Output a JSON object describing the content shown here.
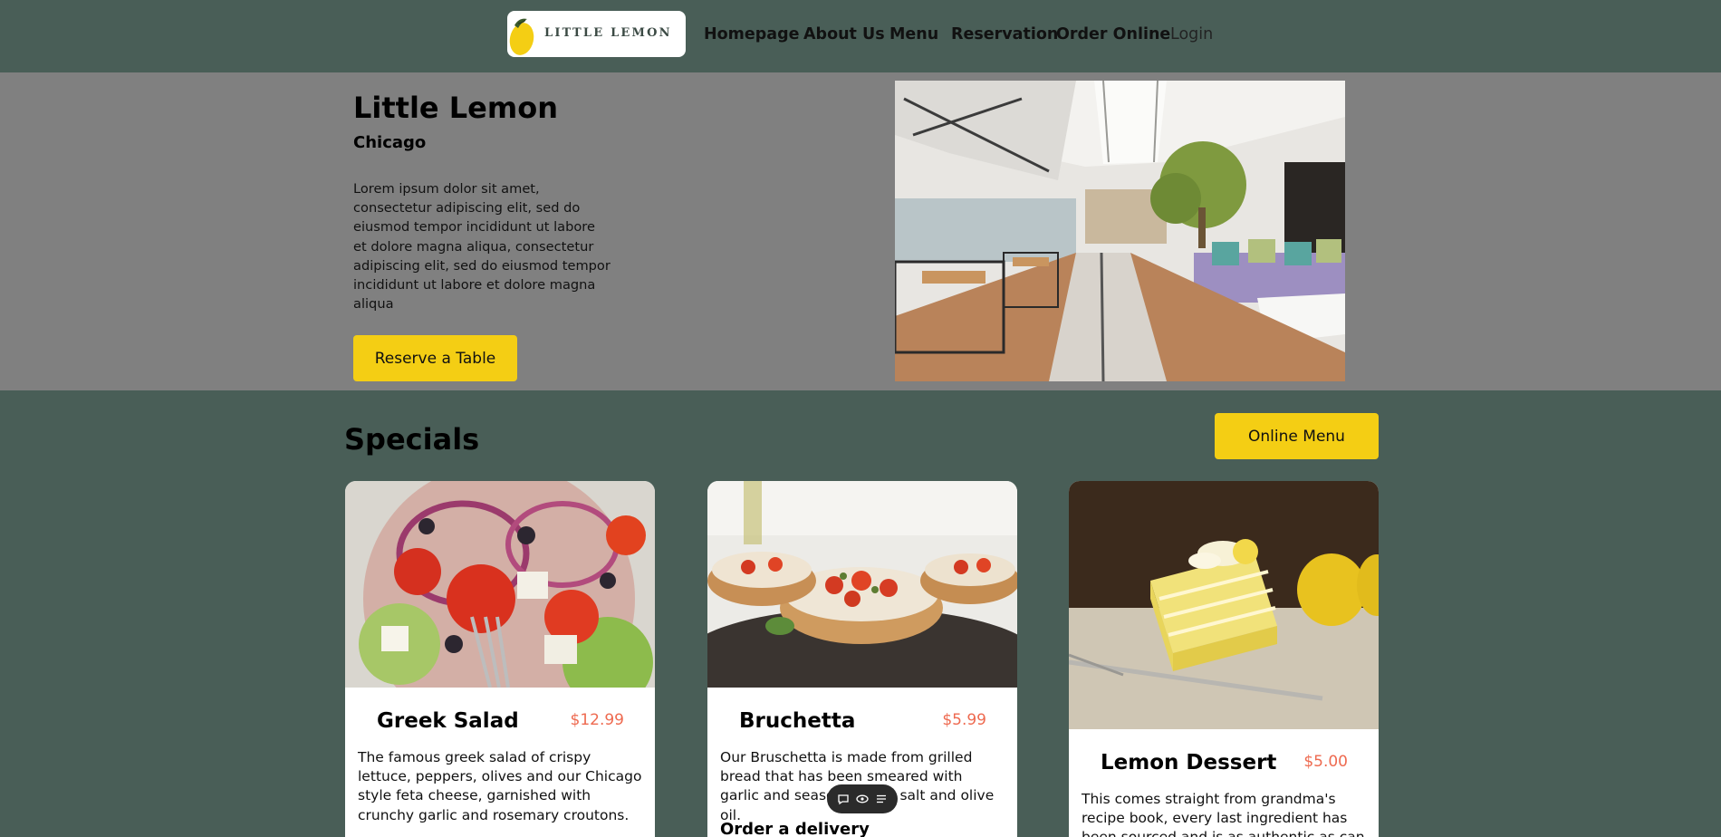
{
  "nav": {
    "logo_text": "LITTLE LEMON",
    "links": [
      "Homepage",
      "About Us",
      "Menu",
      "Reservation",
      "Order Online"
    ],
    "login": "Login"
  },
  "hero": {
    "title": "Little Lemon",
    "subtitle": "Chicago",
    "description": "Lorem ipsum dolor sit amet, consectetur adipiscing elit, sed do eiusmod tempor incididunt ut labore et dolore magna aliqua, consectetur adipiscing elit, sed do eiusmod tempor incididunt ut labore et dolore magna aliqua",
    "button": "Reserve a Table"
  },
  "specials": {
    "title": "Specials",
    "button": "Online Menu",
    "cards": [
      {
        "name": "Greek Salad",
        "price": "$12.99",
        "description": "The famous greek salad of crispy lettuce, peppers, olives and our Chicago style feta cheese, garnished with crunchy garlic and rosemary croutons.",
        "order": ""
      },
      {
        "name": "Bruchetta",
        "price": "$5.99",
        "description": "Our Bruschetta is made from grilled bread that has been smeared with garlic and seasoned with salt and olive oil.",
        "order": "Order a delivery"
      },
      {
        "name": "Lemon Dessert",
        "price": "$5.00",
        "description": "This comes straight from grandma's recipe book, every last ingredient has been sourced and is as authentic as can be.",
        "order": ""
      }
    ]
  },
  "colors": {
    "brand_green": "#495e57",
    "brand_yellow": "#f4ce14",
    "hero_gray": "#808080",
    "price": "#ee6a50"
  },
  "floating_toolbar": {
    "icons": [
      "chat-icon",
      "eye-icon",
      "list-icon"
    ]
  }
}
